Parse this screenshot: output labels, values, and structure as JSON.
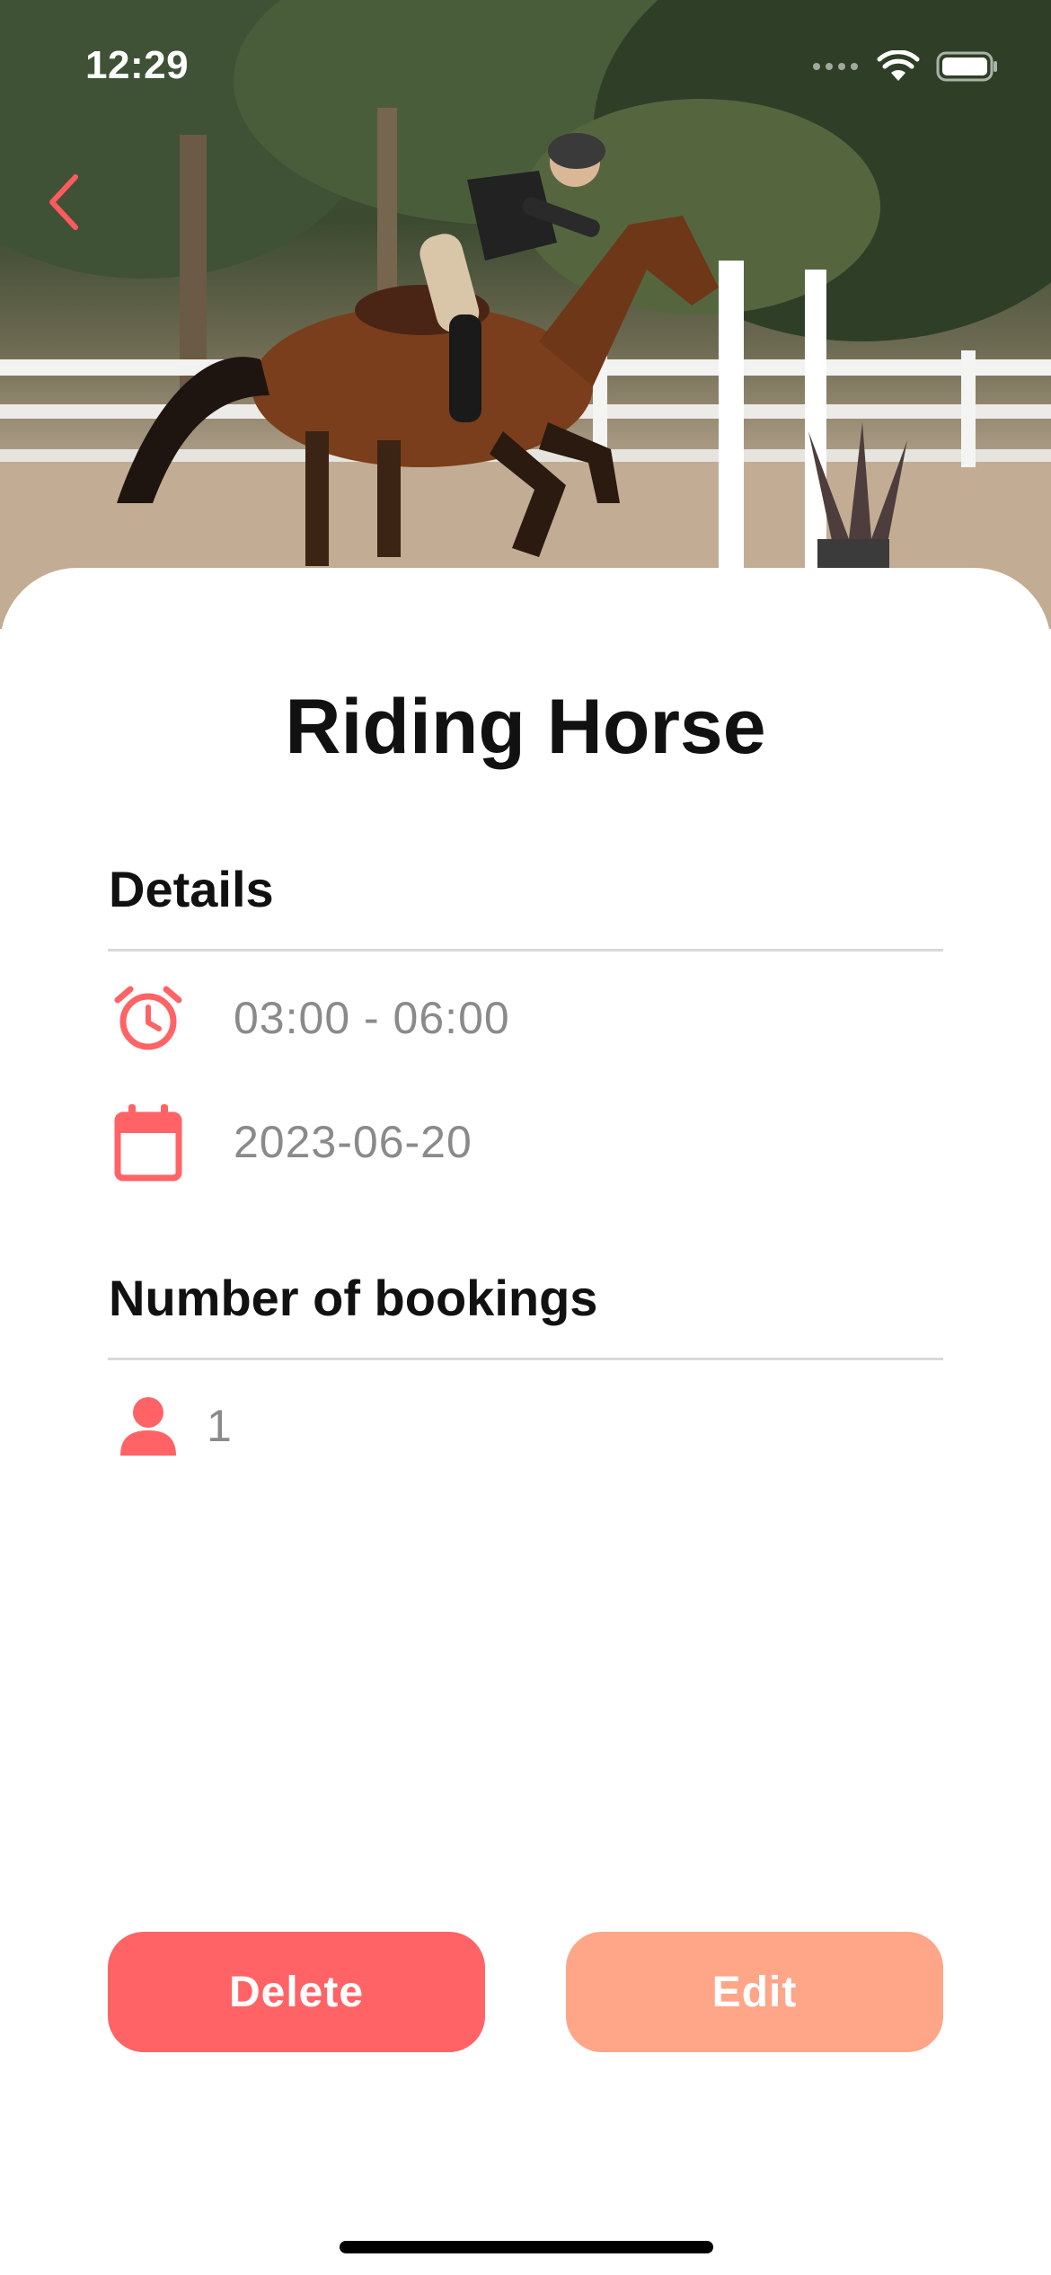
{
  "status_bar": {
    "time": "12:29"
  },
  "event": {
    "title": "Riding Horse"
  },
  "details": {
    "heading": "Details",
    "time_range": "03:00 - 06:00",
    "date": "2023-06-20"
  },
  "bookings": {
    "heading": "Number of bookings",
    "count": "1"
  },
  "actions": {
    "delete_label": "Delete",
    "edit_label": "Edit"
  },
  "icons": {
    "back": "chevron-left-icon",
    "clock": "alarm-clock-icon",
    "calendar": "calendar-icon",
    "person": "person-icon"
  },
  "colors": {
    "accent": "#ff6366",
    "edit": "#ffa588",
    "value_text": "#8a8a8a",
    "divider": "#d9d9d9"
  }
}
